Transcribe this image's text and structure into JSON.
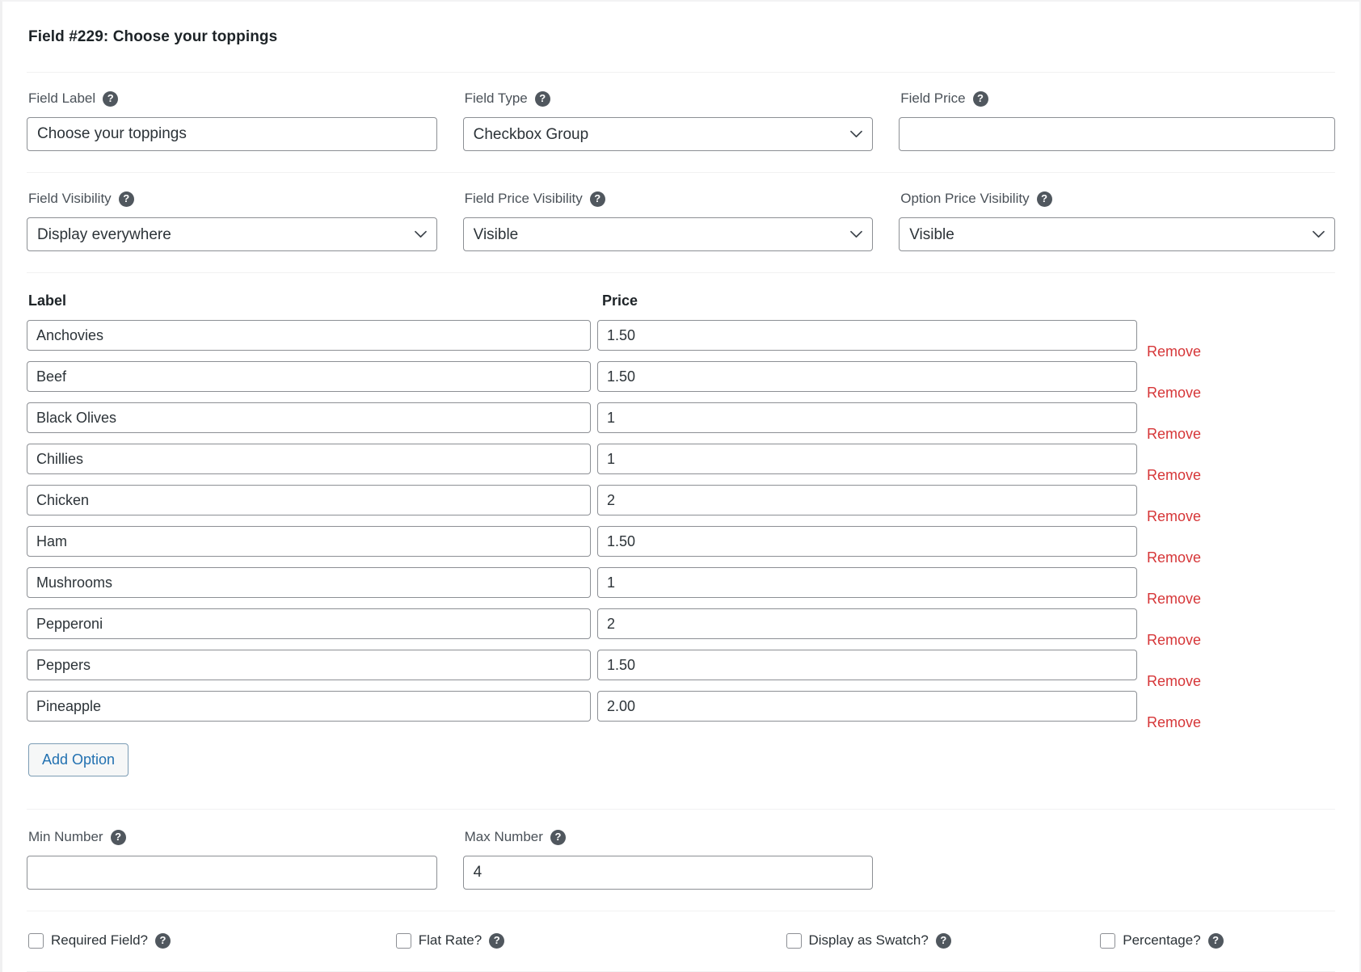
{
  "header": {
    "title": "Field #229: Choose your toppings"
  },
  "settings_row_1": {
    "field_label": {
      "label": "Field Label",
      "help": "?",
      "value": "Choose your toppings",
      "placeholder": ""
    },
    "field_type": {
      "label": "Field Type",
      "help": "?",
      "value": "Checkbox Group",
      "options": [
        "Checkbox Group"
      ]
    },
    "field_price": {
      "label": "Field Price",
      "help": "?",
      "value": "",
      "placeholder": ""
    }
  },
  "settings_row_2": {
    "field_visibility": {
      "label": "Field Visibility",
      "help": "?",
      "value": "Display everywhere",
      "options": [
        "Display everywhere"
      ]
    },
    "field_price_visibility": {
      "label": "Field Price Visibility",
      "help": "?",
      "value": "Visible",
      "options": [
        "Visible"
      ]
    },
    "option_price_visibility": {
      "label": "Option Price Visibility",
      "help": "?",
      "value": "Visible",
      "options": [
        "Visible"
      ]
    }
  },
  "options_table": {
    "headers": {
      "label": "Label",
      "price": "Price"
    },
    "remove_label": "Remove",
    "rows": [
      {
        "label": "Anchovies",
        "price": "1.50"
      },
      {
        "label": "Beef",
        "price": "1.50"
      },
      {
        "label": "Black Olives",
        "price": "1"
      },
      {
        "label": "Chillies",
        "price": "1"
      },
      {
        "label": "Chicken",
        "price": "2"
      },
      {
        "label": "Ham",
        "price": "1.50"
      },
      {
        "label": "Mushrooms",
        "price": "1"
      },
      {
        "label": "Pepperoni",
        "price": "2"
      },
      {
        "label": "Peppers",
        "price": "1.50"
      },
      {
        "label": "Pineapple",
        "price": "2.00"
      }
    ],
    "add_option_label": "Add Option"
  },
  "number_limits": {
    "min_number": {
      "label": "Min Number",
      "help": "?",
      "value": "",
      "placeholder": ""
    },
    "max_number": {
      "label": "Max Number",
      "help": "?",
      "value": "4",
      "placeholder": ""
    }
  },
  "toggles": [
    {
      "label": "Required Field?",
      "help": "?",
      "checked": false
    },
    {
      "label": "Flat Rate?",
      "help": "?",
      "checked": false
    },
    {
      "label": "Display as Swatch?",
      "help": "?",
      "checked": false
    },
    {
      "label": "Percentage?",
      "help": "?",
      "checked": false
    }
  ],
  "colors": {
    "remove_link": "#d63638",
    "accent_blue": "#2271b1",
    "border": "#8c8f94",
    "help_bg": "#50575e",
    "text": "#2c3338"
  }
}
